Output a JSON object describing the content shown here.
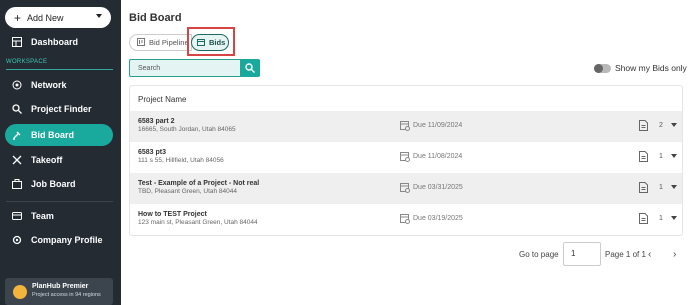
{
  "sidebar": {
    "add_new": "Add New",
    "workspace_label": "WORKSPACE",
    "items": [
      {
        "label": "Dashboard",
        "icon": "dashboard-icon"
      },
      {
        "label": "Network",
        "icon": "network-icon"
      },
      {
        "label": "Project Finder",
        "icon": "search-icon"
      },
      {
        "label": "Bid Board",
        "icon": "bid-board-icon",
        "active": true
      },
      {
        "label": "Takeoff",
        "icon": "takeoff-icon"
      },
      {
        "label": "Job Board",
        "icon": "job-board-icon"
      },
      {
        "label": "Team",
        "icon": "team-icon"
      },
      {
        "label": "Company Profile",
        "icon": "company-profile-icon"
      }
    ],
    "premium": {
      "title": "PlanHub Premier",
      "subtitle": "Project access in 94 regions"
    }
  },
  "main": {
    "title": "Bid Board",
    "tabs": [
      {
        "label": "Bid Pipeline",
        "selected": false
      },
      {
        "label": "Bids",
        "selected": true
      }
    ],
    "search_placeholder": "Search",
    "toggle_label": "Show my Bids only",
    "table": {
      "header": "Project Name",
      "rows": [
        {
          "name": "6583 part 2",
          "address": "16665, South Jordan, Utah 84065",
          "due": "Due 11/09/2024",
          "count": "2"
        },
        {
          "name": "6583 pt3",
          "address": "111 s 55, Hillfield, Utah 84056",
          "due": "Due 11/08/2024",
          "count": "1"
        },
        {
          "name": "Test - Example of a Project - Not real",
          "address": "TBD, Pleasant Green, Utah 84044",
          "due": "Due 03/31/2025",
          "count": "1"
        },
        {
          "name": "How to TEST Project",
          "address": "123 main st, Pleasant Green, Utah 84044",
          "due": "Due 03/19/2025",
          "count": "1"
        }
      ]
    },
    "pagination": {
      "goto_label": "Go to page",
      "page_input": "1",
      "page_info": "Page 1 of 1"
    }
  },
  "colors": {
    "accent": "#1aa99d",
    "sidebar_bg": "#242b33",
    "highlight": "#d64545"
  }
}
